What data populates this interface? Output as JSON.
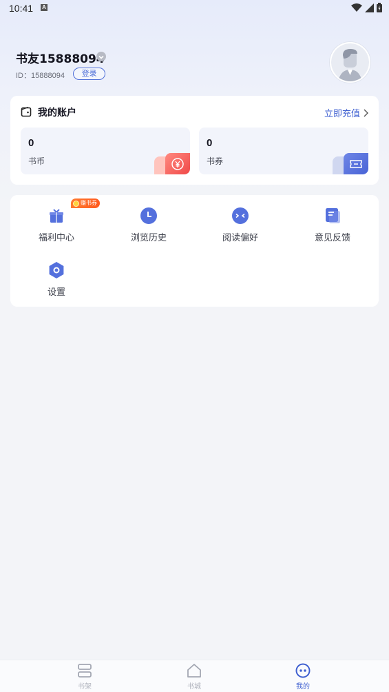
{
  "status_bar": {
    "time": "10:41",
    "notification": "A"
  },
  "profile": {
    "name": "书友15888094",
    "id_label": "ID：15888094",
    "login_label": "登录"
  },
  "account": {
    "title": "我的账户",
    "recharge_label": "立即充值",
    "coins": {
      "value": "0",
      "label": "书币"
    },
    "vouchers": {
      "value": "0",
      "label": "书券"
    }
  },
  "menu": {
    "promo_badge": "赚书券",
    "items": [
      {
        "label": "福利中心",
        "icon": "gift-icon"
      },
      {
        "label": "浏览历史",
        "icon": "clock-icon"
      },
      {
        "label": "阅读偏好",
        "icon": "preference-icon"
      },
      {
        "label": "意见反馈",
        "icon": "feedback-icon"
      },
      {
        "label": "设置",
        "icon": "settings-icon"
      }
    ]
  },
  "bottom_nav": {
    "items": [
      {
        "label": "书架",
        "icon": "bookshelf-icon"
      },
      {
        "label": "书城",
        "icon": "home-icon"
      },
      {
        "label": "我的",
        "icon": "profile-icon"
      }
    ],
    "active": "我的"
  },
  "colors": {
    "accent": "#3e5fd0",
    "icon_blue": "#5470dd",
    "coin_red": "#f2504f",
    "promo_orange": "#ff6a24"
  }
}
